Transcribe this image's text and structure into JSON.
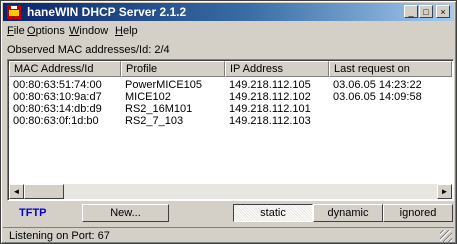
{
  "window": {
    "title": "haneWIN DHCP Server 2.1.2",
    "buttons": [
      "_",
      "□",
      "×"
    ]
  },
  "menu": {
    "items": [
      {
        "mnemonic": "F",
        "rest": "ile"
      },
      {
        "mnemonic": "O",
        "rest": "ptions"
      },
      {
        "mnemonic": "W",
        "rest": "indow"
      },
      {
        "mnemonic": "H",
        "rest": "elp"
      }
    ]
  },
  "observed": {
    "label": "Observed MAC addresses/Id:  2/4"
  },
  "table": {
    "columns": [
      "MAC Address/Id",
      "Profile",
      "IP Address",
      "Last request on"
    ],
    "rows": [
      [
        "00:80:63:51:74:00",
        "PowerMICE105",
        "149.218.112.105",
        "03.06.05 14:23:22"
      ],
      [
        "00:80:63:10:9a:d7",
        "MICE102",
        "149.218.112.102",
        "03.06.05 14:09:58"
      ],
      [
        "00:80:63:14:db:d9",
        "RS2_16M101",
        "149.218.112.101",
        ""
      ],
      [
        "00:80:63:0f:1d:b0",
        "RS2_7_103",
        "149.218.112.103",
        ""
      ]
    ]
  },
  "scroll": {
    "left_arrow": "◄",
    "right_arrow": "►"
  },
  "bottom": {
    "tftp_label": "TFTP",
    "new_button": "New...",
    "static_button": "static",
    "dynamic_button": "dynamic",
    "ignored_button": "ignored"
  },
  "status": {
    "text": "Listening on Port: 67"
  },
  "colors": {
    "title_start": "#0a246a",
    "title_end": "#a6caf0",
    "tftp": "#0000cc"
  }
}
